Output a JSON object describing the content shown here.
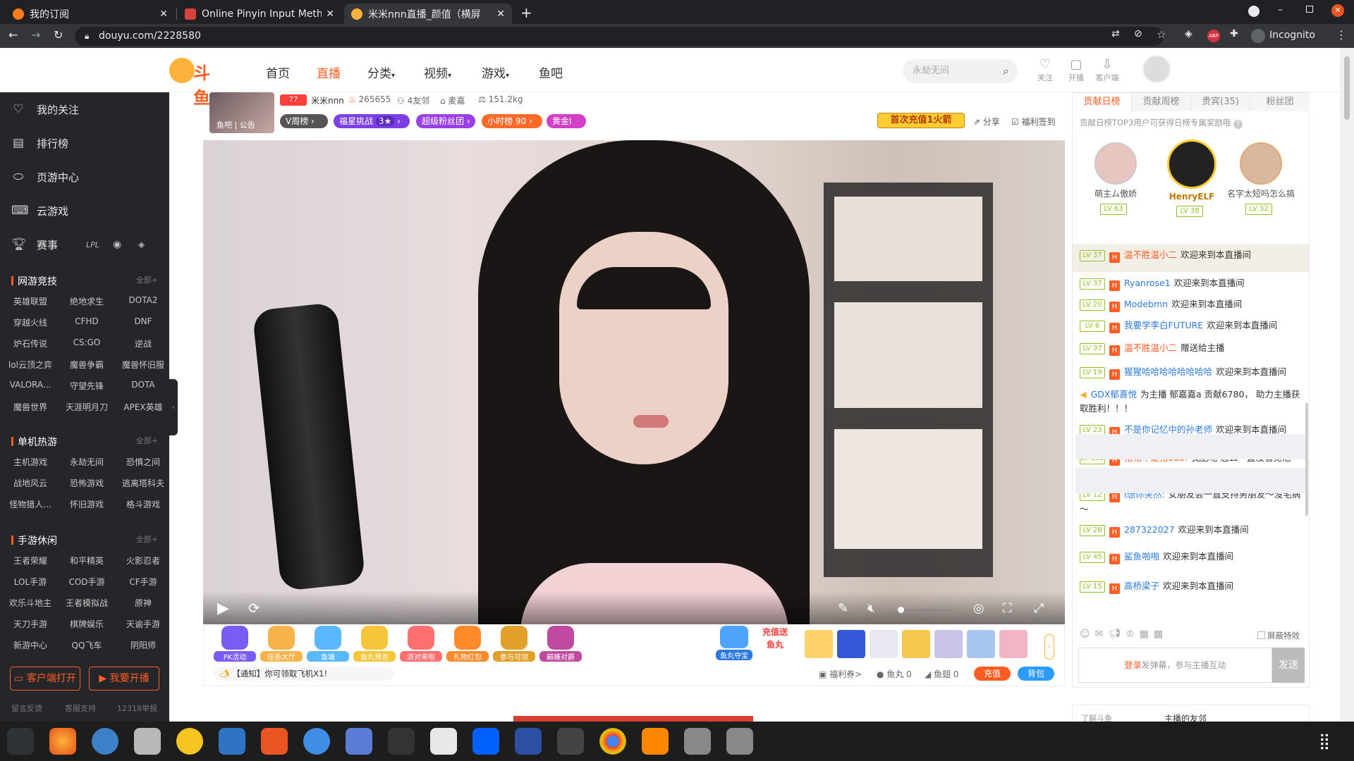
{
  "browser": {
    "tabs": [
      {
        "title": "我的订阅",
        "active": false
      },
      {
        "title": "Online Pinyin Input Metho",
        "active": false
      },
      {
        "title": "米米nnn直播_颜值（横屏",
        "active": true
      }
    ],
    "url": "douyu.com/2228580",
    "profile": "Incognito"
  },
  "header": {
    "logo": "斗鱼",
    "nav": [
      "首页",
      "直播",
      "分类",
      "视频",
      "游戏",
      "鱼吧"
    ],
    "search_placeholder": "永劫无间",
    "icons": [
      {
        "label": "关注"
      },
      {
        "label": "开播"
      },
      {
        "label": "客户端"
      }
    ]
  },
  "sidebar": {
    "items": [
      "我的关注",
      "排行榜",
      "页游中心",
      "云游戏",
      "赛事"
    ],
    "sections": [
      {
        "title": "网游竞技",
        "all": "全部",
        "games": [
          "英雄联盟",
          "绝地求生",
          "DOTA2",
          "穿越火线",
          "CFHD",
          "DNF",
          "炉石传说",
          "CS:GO",
          "逆战",
          "lol云顶之弈",
          "魔兽争霸",
          "魔兽怀旧服",
          "VALORA...",
          "守望先锋",
          "DOTA",
          "魔兽世界",
          "天涯明月刀",
          "APEX英雄"
        ]
      },
      {
        "title": "单机热游",
        "all": "全部",
        "games": [
          "主机游戏",
          "永劫无间",
          "恐惧之间",
          "战地风云",
          "恐怖游戏",
          "逃离塔科夫",
          "怪物猎人...",
          "怀旧游戏",
          "格斗游戏"
        ]
      },
      {
        "title": "手游休闲",
        "all": "全部",
        "games": [
          "王者荣耀",
          "和平精英",
          "火影忍者",
          "LOL手游",
          "COD手游",
          "CF手游",
          "欢乐斗地主",
          "王者模拟战",
          "原神",
          "天刀手游",
          "棋牌娱乐",
          "天谕手游",
          "新游中心",
          "QQ飞车",
          "阴阳师"
        ]
      }
    ],
    "buttons": [
      "客户端打开",
      "我要开播"
    ],
    "footer": [
      "留言反馈",
      "客服支持",
      "12318举报"
    ]
  },
  "room": {
    "thumb_text": "鱼吧 | 公告",
    "level_badge": "77",
    "anchor": "米米nnn",
    "hot": "265655",
    "friends": "4友邻",
    "mic": "麦嘉",
    "weight": "151.2kg",
    "badges": [
      "V周榜",
      "福星挑战",
      "3★",
      "超级粉丝团",
      "小时榜",
      "90",
      "黄金Ⅰ"
    ],
    "first_recharge": "首次充值1火箭",
    "share": "分享",
    "checkin": "福利签到"
  },
  "gifts": {
    "items": [
      "PK活动",
      "任务大厅",
      "鱼塘",
      "鱼丸预言",
      "派对来啦",
      "礼物红包",
      "参与可领",
      "巅峰对爵"
    ],
    "right_items": [
      "鱼丸夺宝",
      "充值送鱼丸"
    ],
    "notice": "【通知】你可领取飞机X1!",
    "coupon": "福利券>",
    "fishball": "鱼丸 0",
    "fishfin": "鱼翅 0",
    "recharge": "充值",
    "backpack": "背包"
  },
  "rank": {
    "tabs": [
      "贡献日榜",
      "贡献周榜",
      "贵宾(35)",
      "粉丝团"
    ],
    "tip": "贡献日榜TOP3用户可获得日榜专属奖励哦",
    "top3": [
      {
        "rank": "2",
        "name": "萌主ム傲娇",
        "level": "LV 63"
      },
      {
        "rank": "1",
        "name": "HenryELF",
        "level": "LV 38"
      },
      {
        "rank": "3",
        "name": "名字太短吗怎么搞",
        "level": "LV 32"
      }
    ]
  },
  "chat": [
    {
      "lv": "LV 37",
      "name": "温不胜温小二",
      "text": "欢迎来到本直播间",
      "color": "#ff5d23"
    },
    {
      "lv": "LV 37",
      "name": "Ryanrose1",
      "text": "欢迎来到本直播间",
      "color": "#2b7adf"
    },
    {
      "lv": "LV 20",
      "name": "Modebmn",
      "text": "欢迎来到本直播间",
      "color": "#2b7adf"
    },
    {
      "lv": "LV 6",
      "name": "我要学李白FUTURE",
      "text": "欢迎来到本直播间",
      "color": "#2b7adf"
    },
    {
      "lv": "LV 37",
      "name": "温不胜温小二",
      "text": "赠送给主播",
      "color": "#ff5d23"
    },
    {
      "lv": "LV 19",
      "name": "猩猩哈哈哈哈哈哈哈哈",
      "text": "欢迎来到本直播间",
      "color": "#2b7adf"
    },
    {
      "lv": "",
      "name": "GDX郁喜悦",
      "text": "为主播 郁嘉嘉a 贡献6780， 助力主播获取胜利！！！",
      "color": "#2b7adf"
    },
    {
      "lv": "LV 23",
      "name": "不是你记忆中的孙老师",
      "text": "欢迎来到本直播间",
      "color": "#2b7adf"
    },
    {
      "lv": "LV 123",
      "name": "猪猪不是猪ouo:",
      "text": "我肥呢 怎么一直没看见他",
      "color": "#ff5d23"
    },
    {
      "lv": "LV 12",
      "name": "i想你突然:",
      "text": "女朋友会一直支持男朋友～没毛病～",
      "color": "#2b7adf"
    },
    {
      "lv": "LV 28",
      "name": "287322027",
      "text": "欢迎来到本直播间",
      "color": "#2b7adf"
    },
    {
      "lv": "LV 45",
      "name": "鲨鱼啪啪",
      "text": "欢迎来到本直播间",
      "color": "#2b7adf"
    },
    {
      "lv": "LV 15",
      "name": "高桥梁子",
      "text": "欢迎来到本直播间",
      "color": "#2b7adf"
    }
  ],
  "chat_input": {
    "shield": "屏蔽特效",
    "login": "登录",
    "placeholder": "发弹幕，参与主播互动",
    "send": "发送"
  },
  "lower": {
    "left": "了解斗鱼",
    "right": "主播的友邻"
  }
}
